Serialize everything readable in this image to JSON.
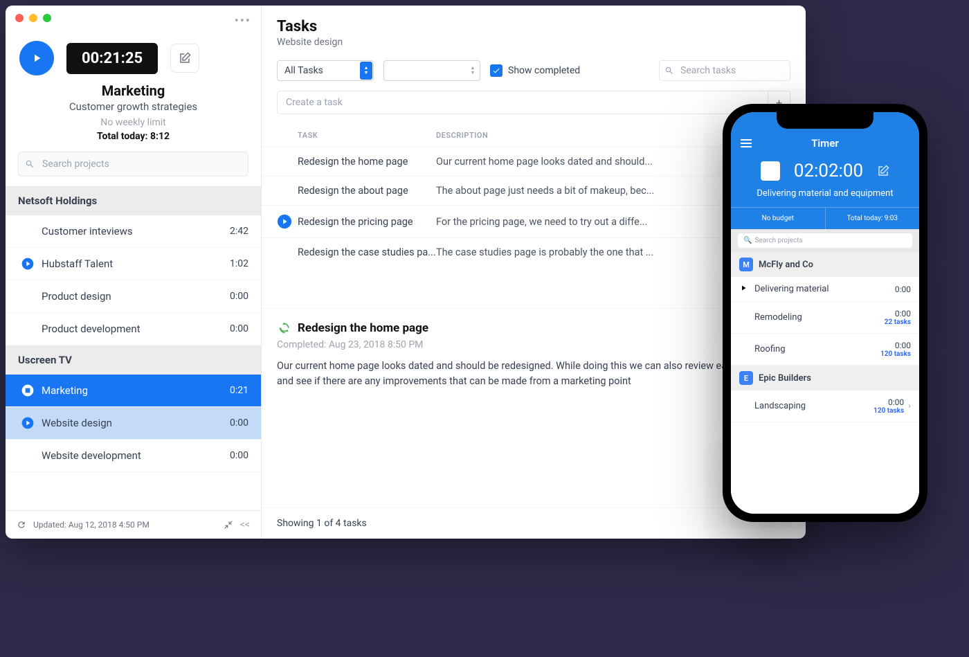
{
  "sidebar": {
    "timer": "00:21:25",
    "project": "Marketing",
    "subtitle": "Customer growth strategies",
    "limit": "No weekly limit",
    "total": "Total today: 8:12",
    "search_placeholder": "Search projects",
    "orgs": [
      {
        "name": "Netsoft Holdings",
        "items": [
          {
            "label": "Customer inteviews",
            "time": "2:42",
            "icon": null,
            "state": ""
          },
          {
            "label": "Hubstaff Talent",
            "time": "1:02",
            "icon": "play",
            "state": ""
          },
          {
            "label": "Product design",
            "time": "0:00",
            "icon": null,
            "state": ""
          },
          {
            "label": "Product development",
            "time": "0:00",
            "icon": null,
            "state": ""
          }
        ]
      },
      {
        "name": "Uscreen TV",
        "items": [
          {
            "label": "Marketing",
            "time": "0:21",
            "icon": "stop",
            "state": "active"
          },
          {
            "label": "Website design",
            "time": "0:00",
            "icon": "play",
            "state": "sub-active"
          },
          {
            "label": "Website development",
            "time": "0:00",
            "icon": null,
            "state": ""
          }
        ]
      }
    ],
    "updated": "Updated: Aug 12, 2018 4:50 PM"
  },
  "main": {
    "title": "Tasks",
    "crumb": "Website design",
    "filter_all": "All Tasks",
    "show_completed": "Show completed",
    "search_placeholder": "Search tasks",
    "create_placeholder": "Create a task",
    "th_task": "TASK",
    "th_desc": "DESCRIPTION",
    "tasks": [
      {
        "name": "Redesign the home page",
        "desc": "Our current home page looks dated and should...",
        "play": false
      },
      {
        "name": "Redesign the about page",
        "desc": "The about page just needs a bit of makeup, bec...",
        "play": false
      },
      {
        "name": "Redesign the pricing page",
        "desc": "For the pricing page, we need to try out a diffe...",
        "play": true
      },
      {
        "name": "Redesign the case studies pa...",
        "desc": "The case studies page is probably the one that ...",
        "play": false
      }
    ],
    "detail": {
      "title": "Redesign the home page",
      "completed": "Completed: Aug 23, 2018 8:50 PM",
      "body": "Our current home page looks dated and should be redesigned. While doing this we can also review each section and see if there are any improvements that can be made from a marketing point"
    },
    "footer": "Showing 1 of 4 tasks"
  },
  "phone": {
    "title": "Timer",
    "time": "02:02:00",
    "task": "Delivering material and equipment",
    "budget": "No budget",
    "total": "Total today: 9:03",
    "search": "Search projects",
    "orgs": [
      {
        "name": "McFly and Co",
        "letter": "M",
        "items": [
          {
            "label": "Delivering material",
            "time": "0:00",
            "tasks": "",
            "icon": "play",
            "chev": false
          },
          {
            "label": "Remodeling",
            "time": "0:00",
            "tasks": "22 tasks",
            "icon": "",
            "chev": false
          },
          {
            "label": "Roofing",
            "time": "0:00",
            "tasks": "120 tasks",
            "icon": "",
            "chev": false
          }
        ]
      },
      {
        "name": "Epic Builders",
        "letter": "E",
        "items": [
          {
            "label": "Landscaping",
            "time": "0:00",
            "tasks": "120 tasks",
            "icon": "",
            "chev": true
          }
        ]
      }
    ]
  }
}
